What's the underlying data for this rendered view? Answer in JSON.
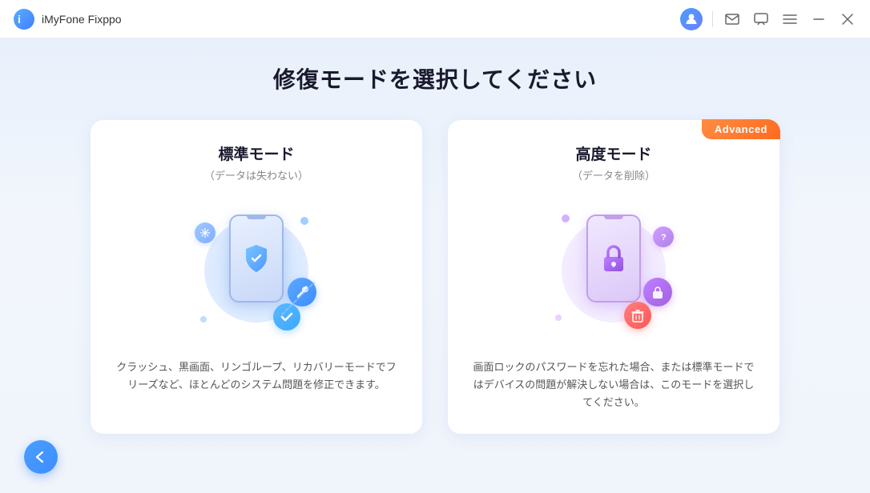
{
  "app": {
    "title": "iMyFone Fixppo"
  },
  "titlebar": {
    "icons": {
      "user": "👤",
      "mail": "✉",
      "chat": "💬",
      "menu": "☰",
      "minimize": "—",
      "close": "✕"
    }
  },
  "page": {
    "title": "修復モードを選択してください",
    "standard_mode": {
      "title": "標準モード",
      "subtitle": "（データは失わない）",
      "description": "クラッシュ、黒画面、リンゴループ、リカバリーモードでフリーズなど、ほとんどのシステム問題を修正できます。"
    },
    "advanced_mode": {
      "badge": "Advanced",
      "title": "高度モード",
      "subtitle": "（データを削除）",
      "description": "画面ロックのパスワードを忘れた場合、または標準モードではデバイスの問題が解決しない場合は、このモードを選択してください。"
    }
  },
  "navigation": {
    "back_label": "←"
  }
}
